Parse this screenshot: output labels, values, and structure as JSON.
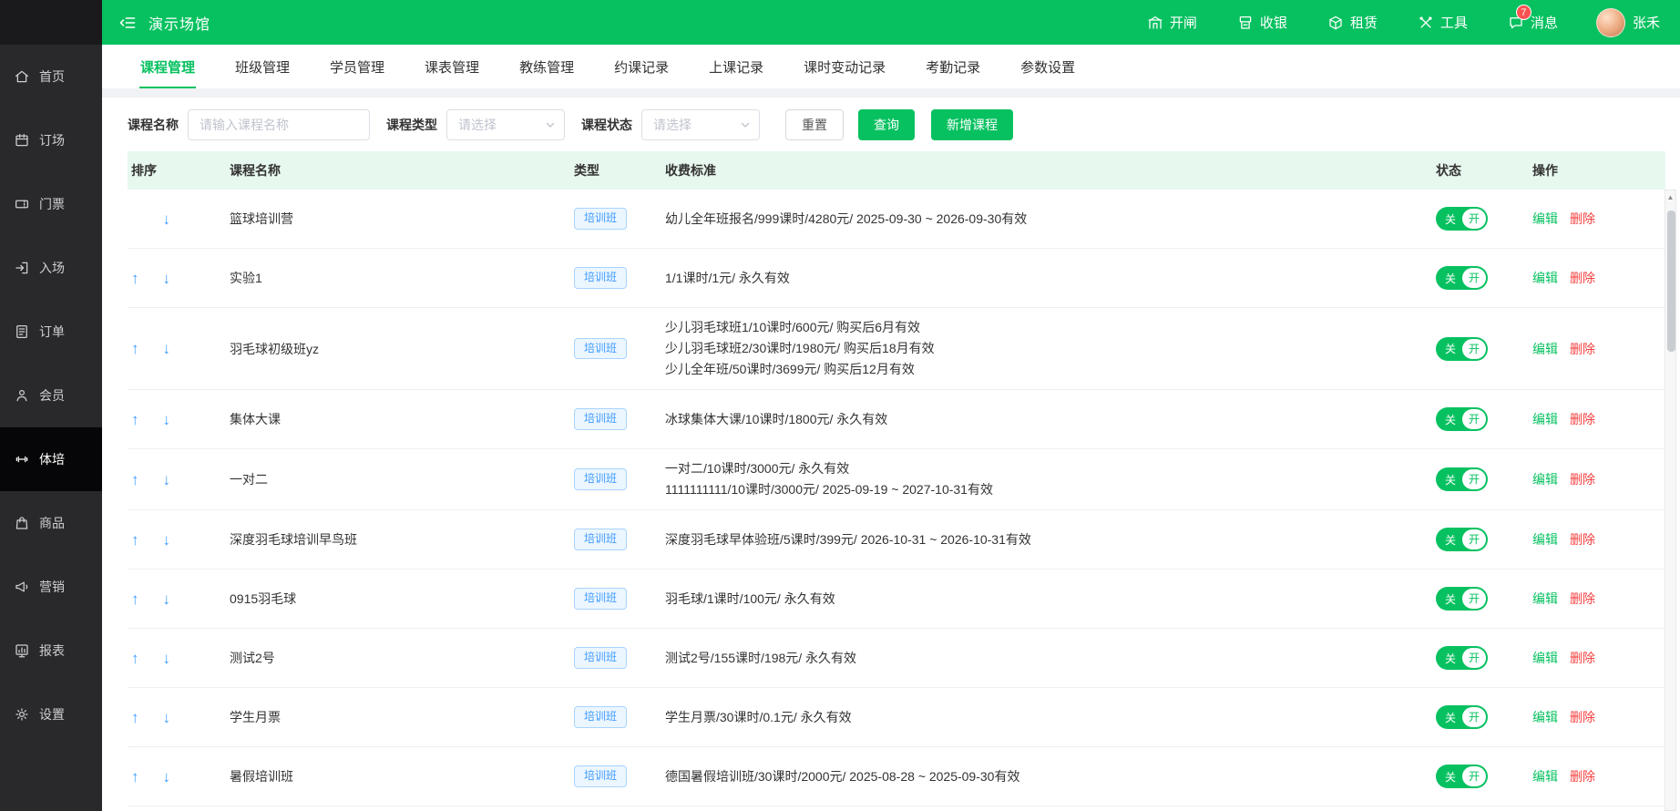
{
  "header": {
    "title": "演示场馆",
    "nav": [
      {
        "id": "gate",
        "label": "开闸",
        "icon": "gate-icon"
      },
      {
        "id": "cashier",
        "label": "收银",
        "icon": "cashier-icon"
      },
      {
        "id": "rental",
        "label": "租赁",
        "icon": "rental-icon"
      },
      {
        "id": "tools",
        "label": "工具",
        "icon": "tools-icon"
      },
      {
        "id": "messages",
        "label": "消息",
        "icon": "message-icon",
        "badge": "7"
      }
    ],
    "user": {
      "name": "张禾"
    }
  },
  "sidebar": {
    "items": [
      {
        "id": "home",
        "label": "首页",
        "icon": "home-icon",
        "active": false
      },
      {
        "id": "booking",
        "label": "订场",
        "icon": "booking-icon",
        "active": false
      },
      {
        "id": "tickets",
        "label": "门票",
        "icon": "ticket-icon",
        "active": false
      },
      {
        "id": "entry",
        "label": "入场",
        "icon": "entry-icon",
        "active": false
      },
      {
        "id": "orders",
        "label": "订单",
        "icon": "order-icon",
        "active": false
      },
      {
        "id": "members",
        "label": "会员",
        "icon": "member-icon",
        "active": false
      },
      {
        "id": "training",
        "label": "体培",
        "icon": "training-icon",
        "active": true
      },
      {
        "id": "goods",
        "label": "商品",
        "icon": "goods-icon",
        "active": false
      },
      {
        "id": "marketing",
        "label": "营销",
        "icon": "marketing-icon",
        "active": false
      },
      {
        "id": "reports",
        "label": "报表",
        "icon": "report-icon",
        "active": false
      },
      {
        "id": "settings",
        "label": "设置",
        "icon": "settings-icon",
        "active": false
      }
    ]
  },
  "tabs": [
    {
      "id": "course-management",
      "label": "课程管理",
      "active": true
    },
    {
      "id": "class-management",
      "label": "班级管理",
      "active": false
    },
    {
      "id": "student-management",
      "label": "学员管理",
      "active": false
    },
    {
      "id": "timetable-management",
      "label": "课表管理",
      "active": false
    },
    {
      "id": "coach-management",
      "label": "教练管理",
      "active": false
    },
    {
      "id": "booking-records",
      "label": "约课记录",
      "active": false
    },
    {
      "id": "lesson-records",
      "label": "上课记录",
      "active": false
    },
    {
      "id": "hour-change-records",
      "label": "课时变动记录",
      "active": false
    },
    {
      "id": "attendance-records",
      "label": "考勤记录",
      "active": false
    },
    {
      "id": "parameter-settings",
      "label": "参数设置",
      "active": false
    }
  ],
  "filters": {
    "name_label": "课程名称",
    "name_placeholder": "请输入课程名称",
    "type_label": "课程类型",
    "type_placeholder": "请选择",
    "status_label": "课程状态",
    "status_placeholder": "请选择",
    "reset_label": "重置",
    "search_label": "查询",
    "add_label": "新增课程"
  },
  "table": {
    "columns": [
      "排序",
      "课程名称",
      "类型",
      "收费标准",
      "状态",
      "操作"
    ],
    "switch": {
      "off": "关",
      "on": "开"
    },
    "actions": {
      "edit": "编辑",
      "delete": "删除"
    },
    "rows": [
      {
        "name": "篮球培训营",
        "type": "培训班",
        "fees": [
          "幼儿全年班报名/999课时/4280元/ 2025-09-30 ~ 2026-09-30有效"
        ],
        "up": false,
        "down": true,
        "status": "on"
      },
      {
        "name": "实验1",
        "type": "培训班",
        "fees": [
          "1/1课时/1元/ 永久有效"
        ],
        "up": true,
        "down": true,
        "status": "on"
      },
      {
        "name": "羽毛球初级班yz",
        "type": "培训班",
        "fees": [
          "少儿羽毛球班1/10课时/600元/ 购买后6月有效",
          "少儿羽毛球班2/30课时/1980元/ 购买后18月有效",
          "少儿全年班/50课时/3699元/ 购买后12月有效"
        ],
        "up": true,
        "down": true,
        "status": "on"
      },
      {
        "name": "集体大课",
        "type": "培训班",
        "fees": [
          "冰球集体大课/10课时/1800元/ 永久有效"
        ],
        "up": true,
        "down": true,
        "status": "on"
      },
      {
        "name": "一对二",
        "type": "培训班",
        "fees": [
          "一对二/10课时/3000元/ 永久有效",
          "1111111111/10课时/3000元/ 2025-09-19 ~ 2027-10-31有效"
        ],
        "up": true,
        "down": true,
        "status": "on"
      },
      {
        "name": "深度羽毛球培训早鸟班",
        "type": "培训班",
        "fees": [
          "深度羽毛球早体验班/5课时/399元/ 2026-10-31 ~ 2026-10-31有效"
        ],
        "up": true,
        "down": true,
        "status": "on"
      },
      {
        "name": "0915羽毛球",
        "type": "培训班",
        "fees": [
          "羽毛球/1课时/100元/ 永久有效"
        ],
        "up": true,
        "down": true,
        "status": "on"
      },
      {
        "name": "测试2号",
        "type": "培训班",
        "fees": [
          "测试2号/155课时/198元/ 永久有效"
        ],
        "up": true,
        "down": true,
        "status": "on"
      },
      {
        "name": "学生月票",
        "type": "培训班",
        "fees": [
          "学生月票/30课时/0.1元/ 永久有效"
        ],
        "up": true,
        "down": true,
        "status": "on"
      },
      {
        "name": "暑假培训班",
        "type": "培训班",
        "fees": [
          "德国暑假培训班/30课时/2000元/ 2025-08-28 ~ 2025-09-30有效"
        ],
        "up": true,
        "down": true,
        "status": "on"
      }
    ]
  },
  "colors": {
    "theme_green": "#07c160",
    "table_header_bg": "#e7f8ee",
    "tag_blue": "#3f9bff",
    "arrow_blue": "#409eff",
    "edit_link": "#07c160",
    "delete_link": "#f53f3f",
    "badge_red": "#fa5151",
    "sidebar_bg": "#29292c",
    "sidebar_active_bg": "#060608"
  }
}
